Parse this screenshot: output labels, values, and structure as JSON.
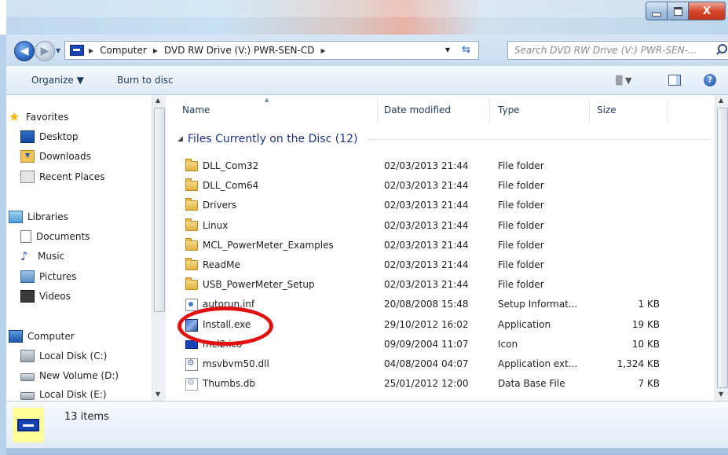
{
  "address": {
    "crumbs": [
      "Computer",
      "DVD RW Drive (V:) PWR-SEN-CD"
    ],
    "search_placeholder": "Search DVD RW Drive (V:) PWR-SEN-..."
  },
  "toolbar": {
    "organize": "Organize ▼",
    "burn": "Burn to disc",
    "view_icon": "▒ ▼",
    "help": "?"
  },
  "nav": {
    "favorites": "Favorites",
    "favorites_items": [
      "Desktop",
      "Downloads",
      "Recent Places"
    ],
    "libraries": "Libraries",
    "libraries_items": [
      "Documents",
      "Music",
      "Pictures",
      "Videos"
    ],
    "computer": "Computer",
    "computer_items": [
      "Local Disk (C:)",
      "New Volume (D:)",
      "Local Disk (E:)"
    ]
  },
  "columns": {
    "name": "Name",
    "date": "Date modified",
    "type": "Type",
    "size": "Size"
  },
  "group_title": "Files Currently on the Disc (12)",
  "files": [
    {
      "name": "DLL_Com32",
      "date": "02/03/2013 21:44",
      "type": "File folder",
      "size": "",
      "icon": "folder-icon"
    },
    {
      "name": "DLL_Com64",
      "date": "02/03/2013 21:44",
      "type": "File folder",
      "size": "",
      "icon": "folder-icon"
    },
    {
      "name": "Drivers",
      "date": "02/03/2013 21:44",
      "type": "File folder",
      "size": "",
      "icon": "folder-icon"
    },
    {
      "name": "Linux",
      "date": "02/03/2013 21:44",
      "type": "File folder",
      "size": "",
      "icon": "folder-icon"
    },
    {
      "name": "MCL_PowerMeter_Examples",
      "date": "02/03/2013 21:44",
      "type": "File folder",
      "size": "",
      "icon": "folder-icon"
    },
    {
      "name": "ReadMe",
      "date": "02/03/2013 21:44",
      "type": "File folder",
      "size": "",
      "icon": "folder-icon"
    },
    {
      "name": "USB_PowerMeter_Setup",
      "date": "02/03/2013 21:44",
      "type": "File folder",
      "size": "",
      "icon": "folder-icon"
    },
    {
      "name": "autorun.inf",
      "date": "20/08/2008 15:48",
      "type": "Setup Informat...",
      "size": "1 KB",
      "icon": "inf-icon"
    },
    {
      "name": "Install.exe",
      "date": "29/10/2012 16:02",
      "type": "Application",
      "size": "19 KB",
      "icon": "exe-icon"
    },
    {
      "name": "mcl2.ico",
      "date": "09/09/2004 11:07",
      "type": "Icon",
      "size": "10 KB",
      "icon": "ico-icon"
    },
    {
      "name": "msvbvm50.dll",
      "date": "04/08/2004 04:07",
      "type": "Application ext...",
      "size": "1,324 KB",
      "icon": "dll-icon"
    },
    {
      "name": "Thumbs.db",
      "date": "25/01/2012 12:00",
      "type": "Data Base File",
      "size": "7 KB",
      "icon": "db-icon"
    }
  ],
  "status": {
    "items_count": "13 items"
  },
  "colors": {
    "highlight_ring": "#e01010",
    "group_title": "#1e3287",
    "details_drive_bg": "#ffff99"
  }
}
